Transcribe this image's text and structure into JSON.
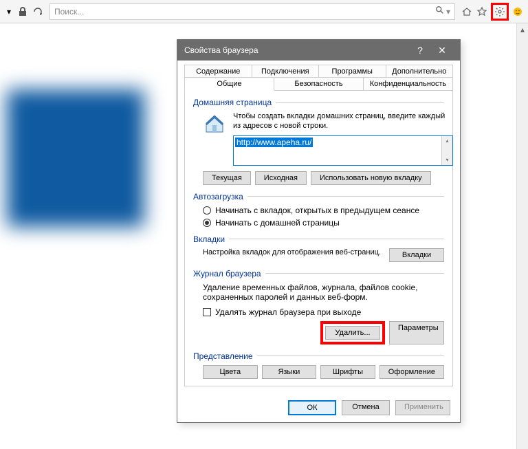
{
  "toolbar": {
    "search_placeholder": "Поиск..."
  },
  "dialog": {
    "title": "Свойства браузера",
    "tabs_row1": [
      "Содержание",
      "Подключения",
      "Программы",
      "Дополнительно"
    ],
    "tabs_row2": [
      "Общие",
      "Безопасность",
      "Конфиденциальность"
    ],
    "active_tab": "Общие",
    "homepage": {
      "group_label": "Домашняя страница",
      "desc": "Чтобы создать вкладки домашних страниц, введите каждый из адресов с новой строки.",
      "url": "http://www.apeha.ru/",
      "buttons": {
        "current": "Текущая",
        "default": "Исходная",
        "newtab": "Использовать новую вкладку"
      }
    },
    "startup": {
      "group_label": "Автозагрузка",
      "option_tabs": "Начинать с вкладок, открытых в предыдущем сеансе",
      "option_home": "Начинать с домашней страницы",
      "selected": "home"
    },
    "tabs": {
      "group_label": "Вкладки",
      "desc": "Настройка вкладок для отображения веб-страниц.",
      "button": "Вкладки"
    },
    "history": {
      "group_label": "Журнал браузера",
      "desc": "Удаление временных файлов, журнала, файлов cookie, сохраненных паролей и данных веб-форм.",
      "checkbox_label": "Удалять журнал браузера при выходе",
      "checked": false,
      "delete_button": "Удалить...",
      "settings_button": "Параметры"
    },
    "appearance": {
      "group_label": "Представление",
      "colors": "Цвета",
      "languages": "Языки",
      "fonts": "Шрифты",
      "accessibility": "Оформление"
    },
    "footer": {
      "ok": "ОК",
      "cancel": "Отмена",
      "apply": "Применить"
    }
  }
}
